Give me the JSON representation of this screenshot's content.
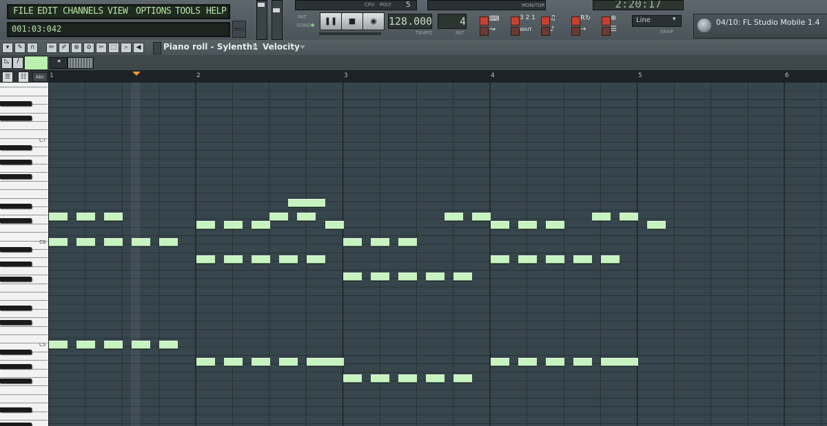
{
  "menu": [
    "FILE",
    "EDIT",
    "CHANNELS",
    "VIEW",
    "OPTIONS",
    "TOOLS",
    "HELP"
  ],
  "song_time": "001:03:042",
  "transport": {
    "cpu_label": "CPU",
    "poly_label": "POLY",
    "poly_value": "5",
    "monitor_label": "MONITOR",
    "pat_label": "PAT",
    "song_label": "SONG",
    "tempo_value": "128.000",
    "tempo_label": "TEMPO",
    "pattern_value": "4",
    "pattern_label": "PAT",
    "time_display": "2:20:17",
    "wait_label": "WAIT",
    "count_label": "3 2 1"
  },
  "snap": {
    "value": "Line",
    "label": "SNAP"
  },
  "hint_text": "04/10: FL Studio Mobile 1.4",
  "pianoroll": {
    "title": "Piano roll - Sylenth1",
    "target": "Velocity",
    "abc_label": "Abc",
    "bars": [
      "1",
      "2",
      "3",
      "4",
      "5",
      "6"
    ],
    "octave_labels": [
      "C7",
      "C6",
      "C5"
    ]
  },
  "colors": {
    "note": "#c6f3c0",
    "playhead": "#e89a2a",
    "grid": "#37454c",
    "lcd_text": "#b7e2a6"
  },
  "notes_rows": [
    {
      "row": "a",
      "starts": [
        6.5,
        7
      ]
    },
    {
      "row": "b",
      "starts": [
        0,
        0.75,
        1.5,
        6,
        6.75,
        10.75,
        11.5,
        14.75,
        15.5
      ]
    },
    {
      "row": "c",
      "starts": [
        4,
        4.75,
        5.5,
        7.5,
        12,
        12.75,
        13.5,
        16.25
      ]
    },
    {
      "row": "d",
      "starts": [
        0,
        0.75,
        1.5,
        2.25,
        3,
        8,
        8.75,
        9.5
      ]
    },
    {
      "row": "e",
      "starts": [
        4,
        4.75,
        5.5,
        6.25,
        7,
        12,
        12.75,
        13.5,
        14.25,
        15
      ]
    },
    {
      "row": "f",
      "starts": [
        8,
        8.75,
        9.5,
        10.25,
        11
      ]
    },
    {
      "row": "g",
      "starts": [
        0,
        0.75,
        1.5,
        2.25,
        3
      ]
    },
    {
      "row": "h",
      "starts": [
        4,
        4.75,
        5.5,
        6.25,
        7,
        7.5,
        12,
        12.75,
        13.5,
        14.25,
        15,
        15.5
      ]
    },
    {
      "row": "i",
      "starts": [
        8,
        8.75,
        9.5,
        10.25,
        11
      ]
    }
  ]
}
